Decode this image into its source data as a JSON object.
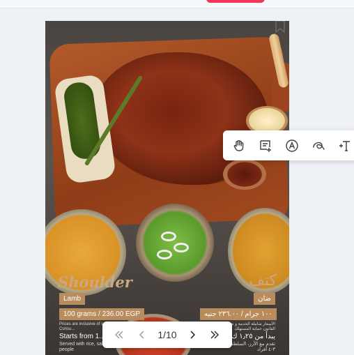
{
  "colors": {
    "accent": "#f2355a",
    "tag": "#b88c5c",
    "title": "#c9a882",
    "icon": "#3a3f4a"
  },
  "icons": {
    "top_action": "top-action-button",
    "bookmark": "bookmark-icon",
    "toolbar": [
      "hand-icon",
      "note-add-icon",
      "font-circle-icon",
      "signature-icon",
      "text-tool-icon"
    ],
    "pager": [
      "first-page-icon",
      "prev-page-icon",
      "next-page-icon",
      "last-page-icon"
    ]
  },
  "poster": {
    "title_en": "Shoulder",
    "title_ar": "كتف",
    "type_en": "Lamb",
    "type_ar": "ضان",
    "weight_price_en": "100 grams / 236.00 EGP",
    "weight_price_ar": "١٠٠ جرام / ٢٣٦.٠٠ جنيه",
    "fine_print_en": "Prices are inclusive of s... according to the Consu...",
    "fine_print_ar": "الأسعار شاملة الخدمة و ضريبة ... وفقا على القانون حماية المستهلك",
    "starts_en": "Starts from 1...",
    "serve_en": "Served with rice, sal... serves 3 - 4 people",
    "starts_ar": "يبدأ من ١٫٢٥ ك",
    "serve_ar": "تقدم مع الأرز، السلطة والمشروبات تكفي ٣-٤ أفراد"
  },
  "pager": {
    "current": "1",
    "total": "10",
    "label": "1/10"
  }
}
